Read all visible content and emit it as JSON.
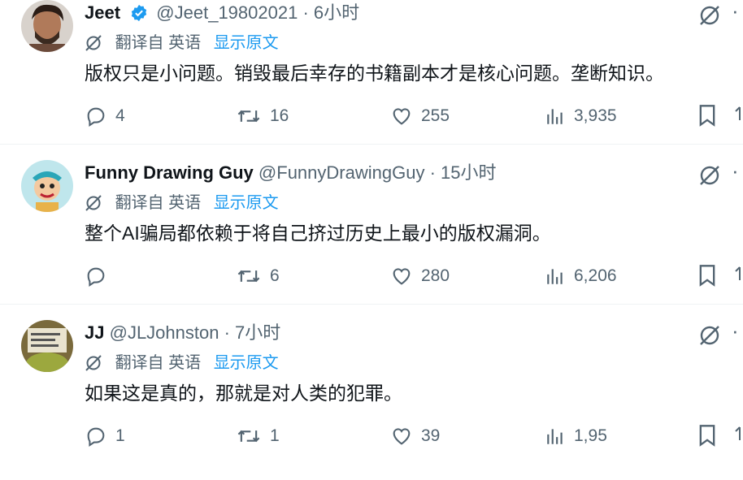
{
  "tweets": [
    {
      "name": "Jeet",
      "verified": true,
      "handle": "@Jeet_19802021",
      "sep": "·",
      "time": "6小时",
      "translated_from": "翻译自 英语",
      "show_original": "显示原文",
      "text": "版权只是小问题。销毁最后幸存的书籍副本才是核心问题。垄断知识。",
      "replies": "4",
      "retweets": "16",
      "likes": "255",
      "views": "3,935"
    },
    {
      "name": "Funny Drawing Guy",
      "verified": false,
      "handle": "@FunnyDrawingGuy",
      "sep": "·",
      "time": "15小时",
      "translated_from": "翻译自 英语",
      "show_original": "显示原文",
      "text": "整个AI骗局都依赖于将自己挤过历史上最小的版权漏洞。",
      "replies": "",
      "retweets": "6",
      "likes": "280",
      "views": "6,206"
    },
    {
      "name": "JJ",
      "verified": false,
      "handle": "@JLJohnston",
      "sep": "·",
      "time": "7小时",
      "translated_from": "翻译自 英语",
      "show_original": "显示原文",
      "text": "如果这是真的，那就是对人类的犯罪。",
      "replies": "1",
      "retweets": "1",
      "likes": "39",
      "views": "1,95"
    }
  ],
  "colors": {
    "accent": "#1d9bf0",
    "muted": "#536471",
    "text": "#0f1419",
    "divider": "#eff3f4"
  },
  "icons": [
    "grok-icon",
    "more-icon",
    "translate-icon",
    "reply-icon",
    "retweet-icon",
    "like-icon",
    "views-icon",
    "bookmark-icon",
    "share-icon",
    "verified-icon"
  ]
}
